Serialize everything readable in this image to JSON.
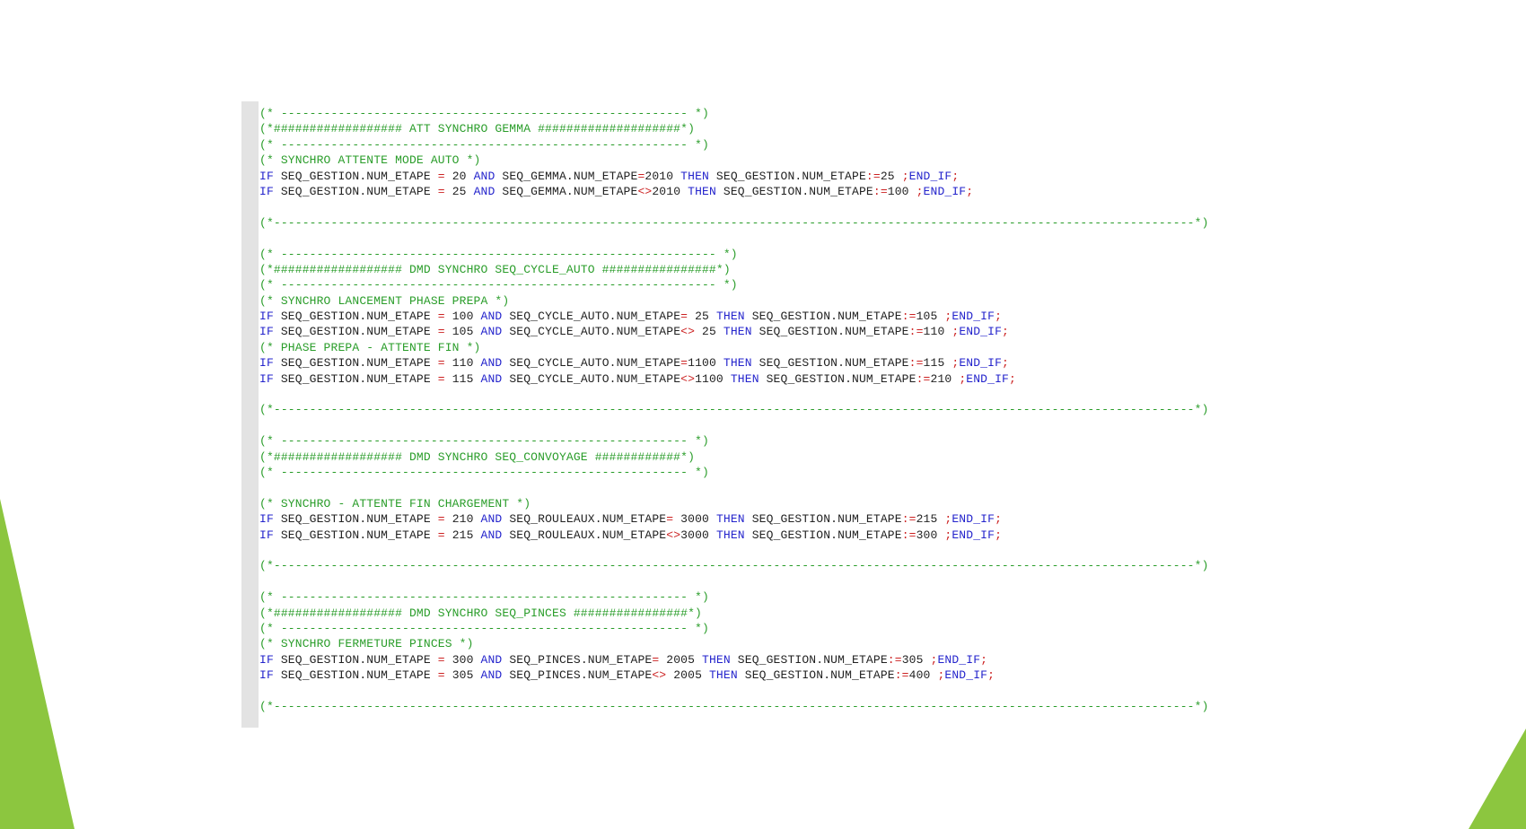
{
  "theme": {
    "accent": "#8cc63f",
    "comment": "#2a9d2a",
    "keyword": "#2424cc",
    "operator": "#cc2222",
    "text": "#222222",
    "gutter": "#e3e3e3"
  },
  "editor": {
    "lines": [
      {
        "segments": [
          {
            "t": "c",
            "v": "(* --------------------------------------------------------- *)"
          }
        ]
      },
      {
        "segments": [
          {
            "t": "c",
            "v": "(*################## ATT SYNCHRO GEMMA ####################*)"
          }
        ]
      },
      {
        "segments": [
          {
            "t": "c",
            "v": "(* --------------------------------------------------------- *)"
          }
        ]
      },
      {
        "segments": [
          {
            "t": "c",
            "v": "(* SYNCHRO ATTENTE MODE AUTO *)"
          }
        ]
      },
      {
        "segments": [
          {
            "t": "k",
            "v": "IF"
          },
          {
            "t": "t",
            "v": " SEQ_GESTION.NUM_ETAPE "
          },
          {
            "t": "o",
            "v": "="
          },
          {
            "t": "t",
            "v": " 20 "
          },
          {
            "t": "k",
            "v": "AND"
          },
          {
            "t": "t",
            "v": " SEQ_GEMMA.NUM_ETAPE"
          },
          {
            "t": "o",
            "v": "="
          },
          {
            "t": "t",
            "v": "2010 "
          },
          {
            "t": "k",
            "v": "THEN"
          },
          {
            "t": "t",
            "v": " SEQ_GESTION.NUM_ETAPE"
          },
          {
            "t": "o",
            "v": ":="
          },
          {
            "t": "t",
            "v": "25 "
          },
          {
            "t": "o",
            "v": ";"
          },
          {
            "t": "k",
            "v": "END_IF"
          },
          {
            "t": "o",
            "v": ";"
          }
        ]
      },
      {
        "segments": [
          {
            "t": "k",
            "v": "IF"
          },
          {
            "t": "t",
            "v": " SEQ_GESTION.NUM_ETAPE "
          },
          {
            "t": "o",
            "v": "="
          },
          {
            "t": "t",
            "v": " 25 "
          },
          {
            "t": "k",
            "v": "AND"
          },
          {
            "t": "t",
            "v": " SEQ_GEMMA.NUM_ETAPE"
          },
          {
            "t": "o",
            "v": "<>"
          },
          {
            "t": "t",
            "v": "2010 "
          },
          {
            "t": "k",
            "v": "THEN"
          },
          {
            "t": "t",
            "v": " SEQ_GESTION.NUM_ETAPE"
          },
          {
            "t": "o",
            "v": ":="
          },
          {
            "t": "t",
            "v": "100 "
          },
          {
            "t": "o",
            "v": ";"
          },
          {
            "t": "k",
            "v": "END_IF"
          },
          {
            "t": "o",
            "v": ";"
          }
        ]
      },
      {
        "segments": []
      },
      {
        "segments": [
          {
            "t": "c",
            "v": "(*---------------------------------------------------------------------------------------------------------------------------------*)"
          }
        ]
      },
      {
        "segments": []
      },
      {
        "segments": [
          {
            "t": "c",
            "v": "(* ------------------------------------------------------------- *)"
          }
        ]
      },
      {
        "segments": [
          {
            "t": "c",
            "v": "(*################## DMD SYNCHRO SEQ_CYCLE_AUTO ################*)"
          }
        ]
      },
      {
        "segments": [
          {
            "t": "c",
            "v": "(* ------------------------------------------------------------- *)"
          }
        ]
      },
      {
        "segments": [
          {
            "t": "c",
            "v": "(* SYNCHRO LANCEMENT PHASE PREPA *)"
          }
        ]
      },
      {
        "segments": [
          {
            "t": "k",
            "v": "IF"
          },
          {
            "t": "t",
            "v": " SEQ_GESTION.NUM_ETAPE "
          },
          {
            "t": "o",
            "v": "="
          },
          {
            "t": "t",
            "v": " 100 "
          },
          {
            "t": "k",
            "v": "AND"
          },
          {
            "t": "t",
            "v": " SEQ_CYCLE_AUTO.NUM_ETAPE"
          },
          {
            "t": "o",
            "v": "="
          },
          {
            "t": "t",
            "v": " 25 "
          },
          {
            "t": "k",
            "v": "THEN"
          },
          {
            "t": "t",
            "v": " SEQ_GESTION.NUM_ETAPE"
          },
          {
            "t": "o",
            "v": ":="
          },
          {
            "t": "t",
            "v": "105 "
          },
          {
            "t": "o",
            "v": ";"
          },
          {
            "t": "k",
            "v": "END_IF"
          },
          {
            "t": "o",
            "v": ";"
          }
        ]
      },
      {
        "segments": [
          {
            "t": "k",
            "v": "IF"
          },
          {
            "t": "t",
            "v": " SEQ_GESTION.NUM_ETAPE "
          },
          {
            "t": "o",
            "v": "="
          },
          {
            "t": "t",
            "v": " 105 "
          },
          {
            "t": "k",
            "v": "AND"
          },
          {
            "t": "t",
            "v": " SEQ_CYCLE_AUTO.NUM_ETAPE"
          },
          {
            "t": "o",
            "v": "<>"
          },
          {
            "t": "t",
            "v": " 25 "
          },
          {
            "t": "k",
            "v": "THEN"
          },
          {
            "t": "t",
            "v": " SEQ_GESTION.NUM_ETAPE"
          },
          {
            "t": "o",
            "v": ":="
          },
          {
            "t": "t",
            "v": "110 "
          },
          {
            "t": "o",
            "v": ";"
          },
          {
            "t": "k",
            "v": "END_IF"
          },
          {
            "t": "o",
            "v": ";"
          }
        ]
      },
      {
        "segments": [
          {
            "t": "c",
            "v": "(* PHASE PREPA - ATTENTE FIN *)"
          }
        ]
      },
      {
        "segments": [
          {
            "t": "k",
            "v": "IF"
          },
          {
            "t": "t",
            "v": " SEQ_GESTION.NUM_ETAPE "
          },
          {
            "t": "o",
            "v": "="
          },
          {
            "t": "t",
            "v": " 110 "
          },
          {
            "t": "k",
            "v": "AND"
          },
          {
            "t": "t",
            "v": " SEQ_CYCLE_AUTO.NUM_ETAPE"
          },
          {
            "t": "o",
            "v": "="
          },
          {
            "t": "t",
            "v": "1100 "
          },
          {
            "t": "k",
            "v": "THEN"
          },
          {
            "t": "t",
            "v": " SEQ_GESTION.NUM_ETAPE"
          },
          {
            "t": "o",
            "v": ":="
          },
          {
            "t": "t",
            "v": "115 "
          },
          {
            "t": "o",
            "v": ";"
          },
          {
            "t": "k",
            "v": "END_IF"
          },
          {
            "t": "o",
            "v": ";"
          }
        ]
      },
      {
        "segments": [
          {
            "t": "k",
            "v": "IF"
          },
          {
            "t": "t",
            "v": " SEQ_GESTION.NUM_ETAPE "
          },
          {
            "t": "o",
            "v": "="
          },
          {
            "t": "t",
            "v": " 115 "
          },
          {
            "t": "k",
            "v": "AND"
          },
          {
            "t": "t",
            "v": " SEQ_CYCLE_AUTO.NUM_ETAPE"
          },
          {
            "t": "o",
            "v": "<>"
          },
          {
            "t": "t",
            "v": "1100 "
          },
          {
            "t": "k",
            "v": "THEN"
          },
          {
            "t": "t",
            "v": " SEQ_GESTION.NUM_ETAPE"
          },
          {
            "t": "o",
            "v": ":="
          },
          {
            "t": "t",
            "v": "210 "
          },
          {
            "t": "o",
            "v": ";"
          },
          {
            "t": "k",
            "v": "END_IF"
          },
          {
            "t": "o",
            "v": ";"
          }
        ]
      },
      {
        "segments": []
      },
      {
        "segments": [
          {
            "t": "c",
            "v": "(*---------------------------------------------------------------------------------------------------------------------------------*)"
          }
        ]
      },
      {
        "segments": []
      },
      {
        "segments": [
          {
            "t": "c",
            "v": "(* --------------------------------------------------------- *)"
          }
        ]
      },
      {
        "segments": [
          {
            "t": "c",
            "v": "(*################## DMD SYNCHRO SEQ_CONVOYAGE ############*)"
          }
        ]
      },
      {
        "segments": [
          {
            "t": "c",
            "v": "(* --------------------------------------------------------- *)"
          }
        ]
      },
      {
        "segments": []
      },
      {
        "segments": [
          {
            "t": "c",
            "v": "(* SYNCHRO - ATTENTE FIN CHARGEMENT *)"
          }
        ]
      },
      {
        "segments": [
          {
            "t": "k",
            "v": "IF"
          },
          {
            "t": "t",
            "v": " SEQ_GESTION.NUM_ETAPE "
          },
          {
            "t": "o",
            "v": "="
          },
          {
            "t": "t",
            "v": " 210 "
          },
          {
            "t": "k",
            "v": "AND"
          },
          {
            "t": "t",
            "v": " SEQ_ROULEAUX.NUM_ETAPE"
          },
          {
            "t": "o",
            "v": "="
          },
          {
            "t": "t",
            "v": " 3000 "
          },
          {
            "t": "k",
            "v": "THEN"
          },
          {
            "t": "t",
            "v": " SEQ_GESTION.NUM_ETAPE"
          },
          {
            "t": "o",
            "v": ":="
          },
          {
            "t": "t",
            "v": "215 "
          },
          {
            "t": "o",
            "v": ";"
          },
          {
            "t": "k",
            "v": "END_IF"
          },
          {
            "t": "o",
            "v": ";"
          }
        ]
      },
      {
        "segments": [
          {
            "t": "k",
            "v": "IF"
          },
          {
            "t": "t",
            "v": " SEQ_GESTION.NUM_ETAPE "
          },
          {
            "t": "o",
            "v": "="
          },
          {
            "t": "t",
            "v": " 215 "
          },
          {
            "t": "k",
            "v": "AND"
          },
          {
            "t": "t",
            "v": " SEQ_ROULEAUX.NUM_ETAPE"
          },
          {
            "t": "o",
            "v": "<>"
          },
          {
            "t": "t",
            "v": "3000 "
          },
          {
            "t": "k",
            "v": "THEN"
          },
          {
            "t": "t",
            "v": " SEQ_GESTION.NUM_ETAPE"
          },
          {
            "t": "o",
            "v": ":="
          },
          {
            "t": "t",
            "v": "300 "
          },
          {
            "t": "o",
            "v": ";"
          },
          {
            "t": "k",
            "v": "END_IF"
          },
          {
            "t": "o",
            "v": ";"
          }
        ]
      },
      {
        "segments": []
      },
      {
        "segments": [
          {
            "t": "c",
            "v": "(*---------------------------------------------------------------------------------------------------------------------------------*)"
          }
        ]
      },
      {
        "segments": []
      },
      {
        "segments": [
          {
            "t": "c",
            "v": "(* --------------------------------------------------------- *)"
          }
        ]
      },
      {
        "segments": [
          {
            "t": "c",
            "v": "(*################## DMD SYNCHRO SEQ_PINCES ################*)"
          }
        ]
      },
      {
        "segments": [
          {
            "t": "c",
            "v": "(* --------------------------------------------------------- *)"
          }
        ]
      },
      {
        "segments": [
          {
            "t": "c",
            "v": "(* SYNCHRO FERMETURE PINCES *)"
          }
        ]
      },
      {
        "segments": [
          {
            "t": "k",
            "v": "IF"
          },
          {
            "t": "t",
            "v": " SEQ_GESTION.NUM_ETAPE "
          },
          {
            "t": "o",
            "v": "="
          },
          {
            "t": "t",
            "v": " 300 "
          },
          {
            "t": "k",
            "v": "AND"
          },
          {
            "t": "t",
            "v": " SEQ_PINCES.NUM_ETAPE"
          },
          {
            "t": "o",
            "v": "="
          },
          {
            "t": "t",
            "v": " 2005 "
          },
          {
            "t": "k",
            "v": "THEN"
          },
          {
            "t": "t",
            "v": " SEQ_GESTION.NUM_ETAPE"
          },
          {
            "t": "o",
            "v": ":="
          },
          {
            "t": "t",
            "v": "305 "
          },
          {
            "t": "o",
            "v": ";"
          },
          {
            "t": "k",
            "v": "END_IF"
          },
          {
            "t": "o",
            "v": ";"
          }
        ]
      },
      {
        "segments": [
          {
            "t": "k",
            "v": "IF"
          },
          {
            "t": "t",
            "v": " SEQ_GESTION.NUM_ETAPE "
          },
          {
            "t": "o",
            "v": "="
          },
          {
            "t": "t",
            "v": " 305 "
          },
          {
            "t": "k",
            "v": "AND"
          },
          {
            "t": "t",
            "v": " SEQ_PINCES.NUM_ETAPE"
          },
          {
            "t": "o",
            "v": "<>"
          },
          {
            "t": "t",
            "v": " 2005 "
          },
          {
            "t": "k",
            "v": "THEN"
          },
          {
            "t": "t",
            "v": " SEQ_GESTION.NUM_ETAPE"
          },
          {
            "t": "o",
            "v": ":="
          },
          {
            "t": "t",
            "v": "400 "
          },
          {
            "t": "o",
            "v": ";"
          },
          {
            "t": "k",
            "v": "END_IF"
          },
          {
            "t": "o",
            "v": ";"
          }
        ]
      },
      {
        "segments": []
      },
      {
        "segments": [
          {
            "t": "c",
            "v": "(*---------------------------------------------------------------------------------------------------------------------------------*)"
          }
        ]
      }
    ]
  }
}
